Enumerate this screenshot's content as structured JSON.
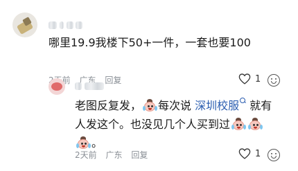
{
  "comment1": {
    "text": "哪里19.9我楼下50+一件，一套也要100",
    "meta": {
      "time": "2天前",
      "location": "广东",
      "reply": "回复"
    },
    "likes": "1"
  },
  "comment2": {
    "text_a": "老图反复发，",
    "text_b": "每次说 ",
    "link": "深圳校服",
    "text_c": " 就有",
    "text_d": "人发这个。也没见几个人买到过",
    "text_e": "。",
    "meta": {
      "time": "2天前",
      "location": "广东",
      "reply": "回复"
    },
    "likes": "1"
  }
}
